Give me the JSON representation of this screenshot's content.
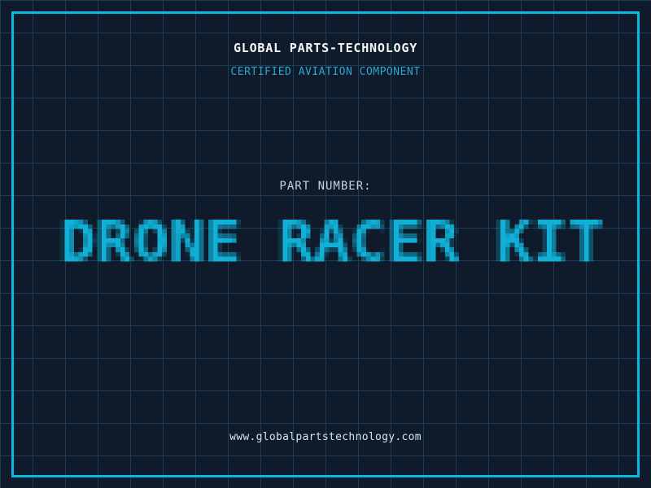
{
  "header": {
    "company": "GLOBAL PARTS-TECHNOLOGY",
    "tagline": "CERTIFIED AVIATION COMPONENT"
  },
  "main": {
    "part_label": "PART NUMBER:",
    "part_number": "DRONE RACER KIT"
  },
  "footer": {
    "website": "www.globalpartstechnology.com"
  },
  "colors": {
    "background": "#0f1a2a",
    "grid_line": "#193f56",
    "frame": "#0db7e6",
    "company_text": "#f4f6f8",
    "tagline_text": "#2da6cd",
    "label_text": "#c6d2dd",
    "part_number_text": "#12b0d6",
    "website_text": "#cfe8ee"
  }
}
